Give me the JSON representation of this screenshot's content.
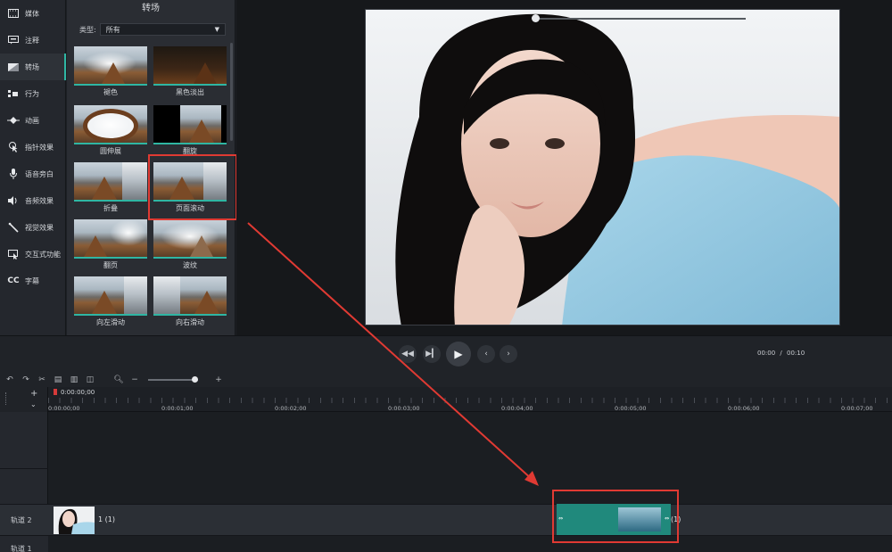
{
  "sidebar": {
    "items": [
      {
        "label": "媒体",
        "icon": "film-icon"
      },
      {
        "label": "注释",
        "icon": "annotation-icon"
      },
      {
        "label": "转场",
        "icon": "transition-icon",
        "active": true
      },
      {
        "label": "行为",
        "icon": "behavior-icon"
      },
      {
        "label": "动画",
        "icon": "animation-icon"
      },
      {
        "label": "指针效果",
        "icon": "cursor-icon"
      },
      {
        "label": "语音旁白",
        "icon": "microphone-icon"
      },
      {
        "label": "音频效果",
        "icon": "speaker-icon"
      },
      {
        "label": "视觉效果",
        "icon": "wand-icon"
      },
      {
        "label": "交互式功能",
        "icon": "interactive-icon"
      },
      {
        "label": "字幕",
        "icon": "cc-icon"
      }
    ]
  },
  "panel": {
    "title": "转场",
    "type_label": "类型:",
    "type_value": "所有",
    "tiles": [
      {
        "label": "褪色"
      },
      {
        "label": "黑色淡出"
      },
      {
        "label": "圆伸展"
      },
      {
        "label": "翻旋"
      },
      {
        "label": "折叠"
      },
      {
        "label": "页面滚动",
        "highlighted": true
      },
      {
        "label": "翻页"
      },
      {
        "label": "波纹"
      },
      {
        "label": "向左滑动"
      },
      {
        "label": "向右滑动"
      }
    ]
  },
  "playback": {
    "current_time": "00:00",
    "separator": "/",
    "duration": "00:10",
    "position_fraction": 0.0
  },
  "timeline": {
    "playhead_time": "0:00:00;00",
    "ruler_labels": [
      "0:00:00;00",
      "0:00:01;00",
      "0:00:02;00",
      "0:00:03;00",
      "0:00:04;00",
      "0:00:05;00",
      "0:00:06;00",
      "0:00:07;00"
    ],
    "zoom_fraction": 0.93,
    "tracks": [
      {
        "name": "轨道 2",
        "clip_label": "1 (1)",
        "transition_label": "(1)"
      },
      {
        "name": "轨道 1"
      }
    ]
  },
  "colors": {
    "accent": "#2fb6a3",
    "highlight": "#e03a33",
    "transition_clip": "#20897c"
  }
}
